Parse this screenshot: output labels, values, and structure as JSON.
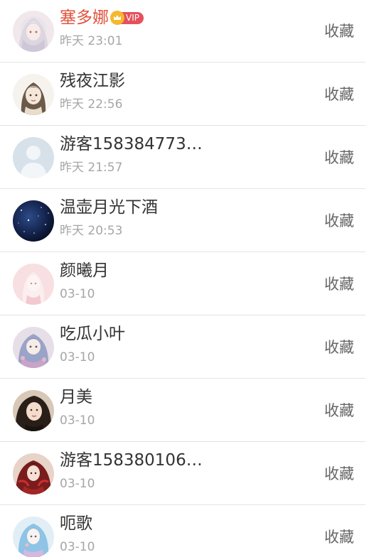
{
  "collect_label": "收藏",
  "items": [
    {
      "name": "塞多娜",
      "vip": true,
      "vip_label": "VIP",
      "time": "昨天 23:01",
      "avatar": "anime-girl-white-hair-avatar"
    },
    {
      "name": "残夜江影",
      "vip": false,
      "time": "昨天 22:56",
      "avatar": "anime-girl-sketch-avatar"
    },
    {
      "name": "游客158384773…",
      "vip": false,
      "time": "昨天 21:57",
      "avatar": "default-user-avatar"
    },
    {
      "name": "温壶月光下酒",
      "vip": false,
      "time": "昨天 20:53",
      "avatar": "starry-night-avatar"
    },
    {
      "name": "颜曦月",
      "vip": false,
      "time": "03-10",
      "avatar": "pink-anime-girl-avatar"
    },
    {
      "name": "吃瓜小叶",
      "vip": false,
      "time": "03-10",
      "avatar": "anime-girl-purple-avatar"
    },
    {
      "name": "月美",
      "vip": false,
      "time": "03-10",
      "avatar": "photo-girl-avatar"
    },
    {
      "name": "游客158380106…",
      "vip": false,
      "time": "03-10",
      "avatar": "red-anime-character-avatar"
    },
    {
      "name": "呃歌",
      "vip": false,
      "time": "03-10",
      "avatar": "blue-anime-girl-avatar"
    }
  ]
}
